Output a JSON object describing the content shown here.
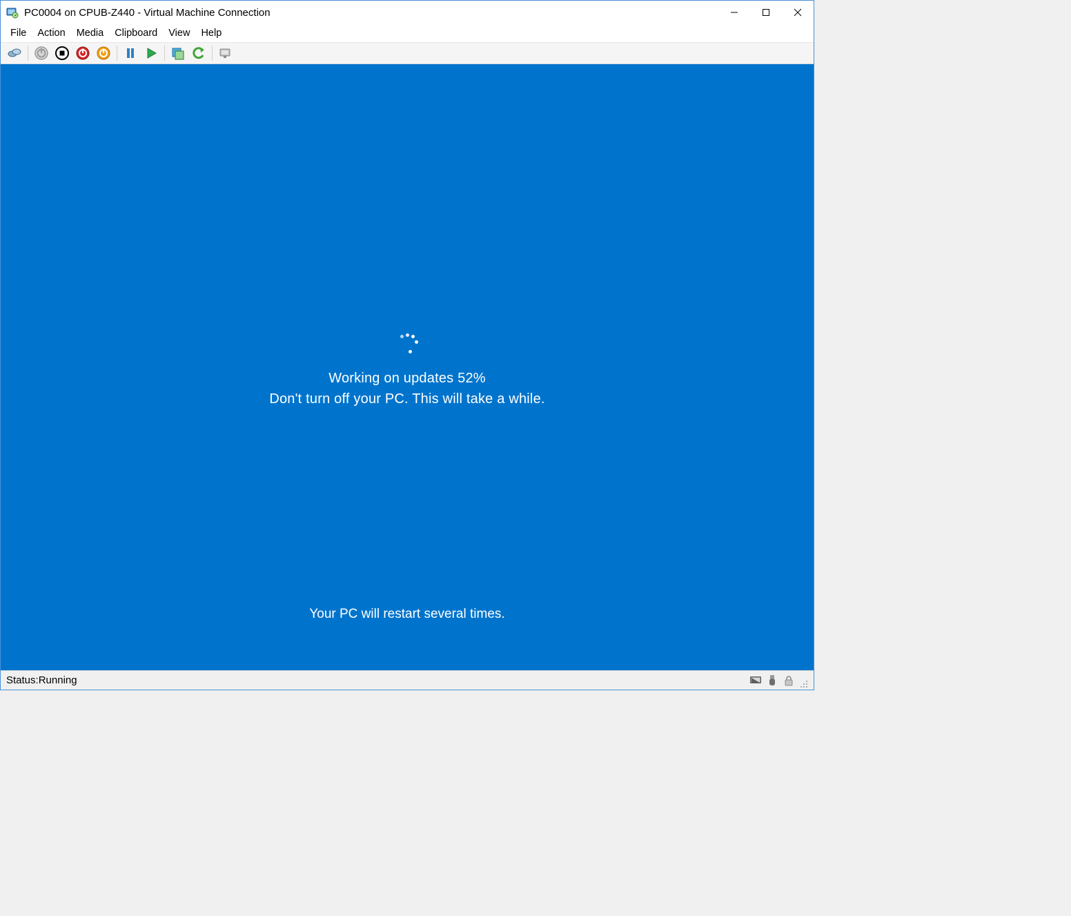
{
  "window": {
    "title": "PC0004 on CPUB-Z440 - Virtual Machine Connection"
  },
  "menu": {
    "items": [
      "File",
      "Action",
      "Media",
      "Clipboard",
      "View",
      "Help"
    ]
  },
  "toolbar": {
    "buttons": [
      {
        "name": "ctrl-alt-del-icon"
      },
      {
        "name": "power-off-icon"
      },
      {
        "name": "stop-icon"
      },
      {
        "name": "shutdown-icon"
      },
      {
        "name": "reset-icon"
      },
      {
        "name": "pause-icon"
      },
      {
        "name": "start-icon"
      },
      {
        "name": "checkpoint-icon"
      },
      {
        "name": "revert-icon"
      },
      {
        "name": "enhanced-session-icon"
      }
    ]
  },
  "vm": {
    "update_prefix": "Working on updates ",
    "update_percent": "52%",
    "update_line2": "Don't turn off your PC. This will take a while.",
    "restart_msg": "Your PC will restart several times."
  },
  "status": {
    "label": "Status: ",
    "value": "Running"
  },
  "colors": {
    "vm_bg": "#0074cd",
    "accent": "#4a90d6"
  }
}
